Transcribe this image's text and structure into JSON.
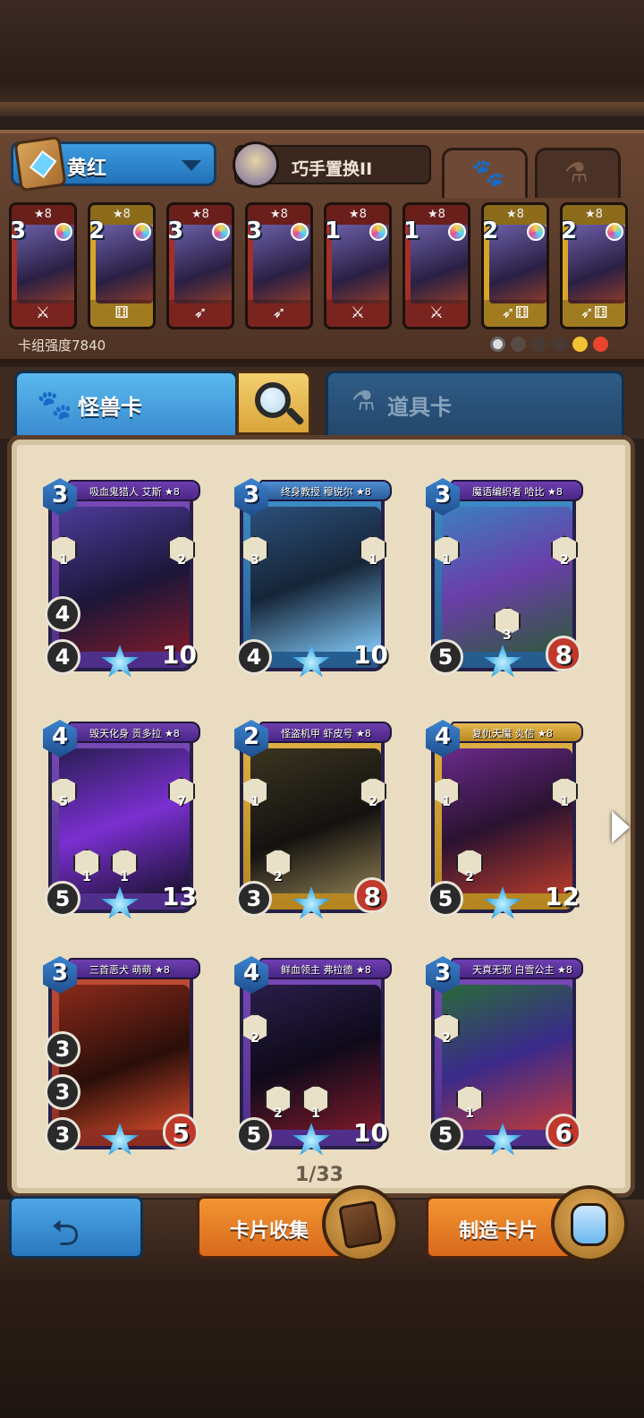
{
  "deck": {
    "name": "黄红",
    "skill_name": "巧手置换II",
    "power_label": "卡组强度7840",
    "mini_cards": [
      {
        "cost": "3",
        "stars": "★8",
        "color": "red"
      },
      {
        "cost": "2",
        "stars": "★8",
        "color": "gold"
      },
      {
        "cost": "3",
        "stars": "★8",
        "color": "red"
      },
      {
        "cost": "3",
        "stars": "★8",
        "color": "red"
      },
      {
        "cost": "1",
        "stars": "★8",
        "color": "red"
      },
      {
        "cost": "1",
        "stars": "★8",
        "color": "red"
      },
      {
        "cost": "2",
        "stars": "★8",
        "color": "gold"
      },
      {
        "cost": "2",
        "stars": "★8",
        "color": "gold"
      }
    ]
  },
  "tabs": {
    "monster": "怪兽卡",
    "item": "道具卡"
  },
  "cards": [
    {
      "cost": "3",
      "title": "吸血鬼猎人 艾斯 ★8",
      "atk": "4",
      "def": "4",
      "hp": "10",
      "frame": "purple",
      "top_left": "1",
      "top_right": "2"
    },
    {
      "cost": "3",
      "title": "终身教授 穆锐尔 ★8",
      "atk": "",
      "def": "4",
      "hp": "10",
      "frame": "blue",
      "top_left": "3",
      "top_right": "1"
    },
    {
      "cost": "3",
      "title": "魔语编织者 哈比 ★8",
      "atk": "",
      "def": "5",
      "hp": "8",
      "frame": "blue",
      "top_left": "1",
      "top_right": "2",
      "mid_right": "3"
    },
    {
      "cost": "4",
      "title": "毁天化身 贡多拉 ★8",
      "atk": "",
      "def": "5",
      "hp": "13",
      "frame": "purple",
      "top_left": "5",
      "top_right": "7",
      "mid_left": "1",
      "mid_right": "1"
    },
    {
      "cost": "2",
      "title": "怪盗机甲 虾皮号 ★8",
      "atk": "",
      "def": "3",
      "hp": "8",
      "frame": "gold",
      "top_left": "1",
      "top_right": "2",
      "mid_left": "2"
    },
    {
      "cost": "4",
      "title": "复仇天魔 炎信 ★8",
      "atk": "",
      "def": "5",
      "hp": "12",
      "frame": "gold",
      "top_left": "1",
      "top_right": "1",
      "mid_left": "2"
    },
    {
      "cost": "3",
      "title": "三首恶犬 萌萌 ★8",
      "atk": "3",
      "def": "3",
      "hp": "5",
      "frame": "red",
      "extra": "3"
    },
    {
      "cost": "4",
      "title": "鲜血领主 弗拉德 ★8",
      "atk": "",
      "def": "5",
      "hp": "10",
      "frame": "red",
      "top_left": "2",
      "mid_left": "2",
      "mid_right": "1"
    },
    {
      "cost": "3",
      "title": "天真无邪 白雪公主 ★8",
      "atk": "",
      "def": "5",
      "hp": "6",
      "frame": "purple",
      "top_left": "2",
      "mid_left": "1"
    }
  ],
  "page_indicator": "1/33",
  "buttons": {
    "collect": "卡片收集",
    "craft": "制造卡片"
  }
}
